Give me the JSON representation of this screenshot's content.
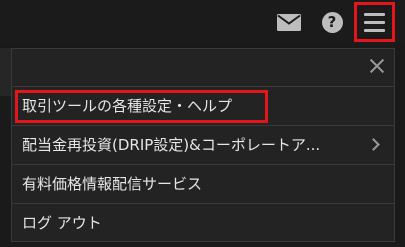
{
  "menu": {
    "items": [
      {
        "label": "取引ツールの各種設定・ヘルプ",
        "highlighted": true,
        "has_submenu": false
      },
      {
        "label": "配当金再投資(DRIP設定)&コーポレートア...",
        "highlighted": false,
        "has_submenu": true
      },
      {
        "label": "有料価格情報配信サービス",
        "highlighted": false,
        "has_submenu": false
      },
      {
        "label": "ログ アウト",
        "highlighted": false,
        "has_submenu": false
      }
    ]
  },
  "icons": {
    "mail": "mail-icon",
    "help": "help-icon",
    "menu": "hamburger-menu-icon",
    "close": "close-icon",
    "submenu": "chevron-right-icon"
  },
  "help_glyph": "?",
  "colors": {
    "background": "#1a1a1a",
    "panel": "#232323",
    "text": "#e6e6e6",
    "icon": "#bdbdbd",
    "highlight": "#e2161b"
  }
}
